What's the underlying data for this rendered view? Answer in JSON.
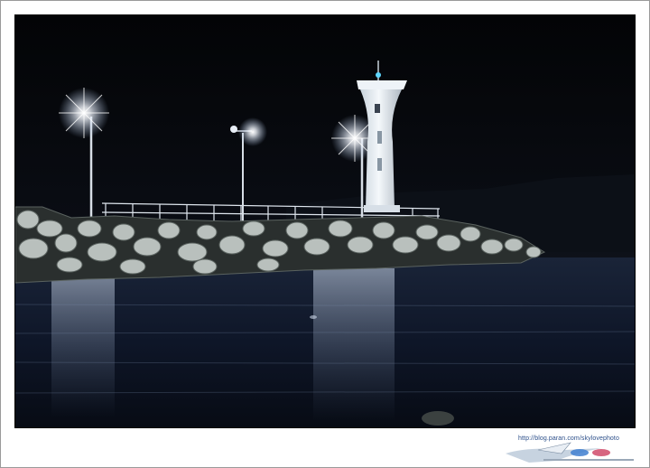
{
  "watermark": {
    "url_text": "http://blog.paran.com/skylovephoto"
  },
  "colors": {
    "sky": "#05070b",
    "water": "#0d1526",
    "lighthouse": "#e8eef4",
    "lamp_glow": "#ffffff",
    "tetrapod": "#b9c0bd"
  }
}
